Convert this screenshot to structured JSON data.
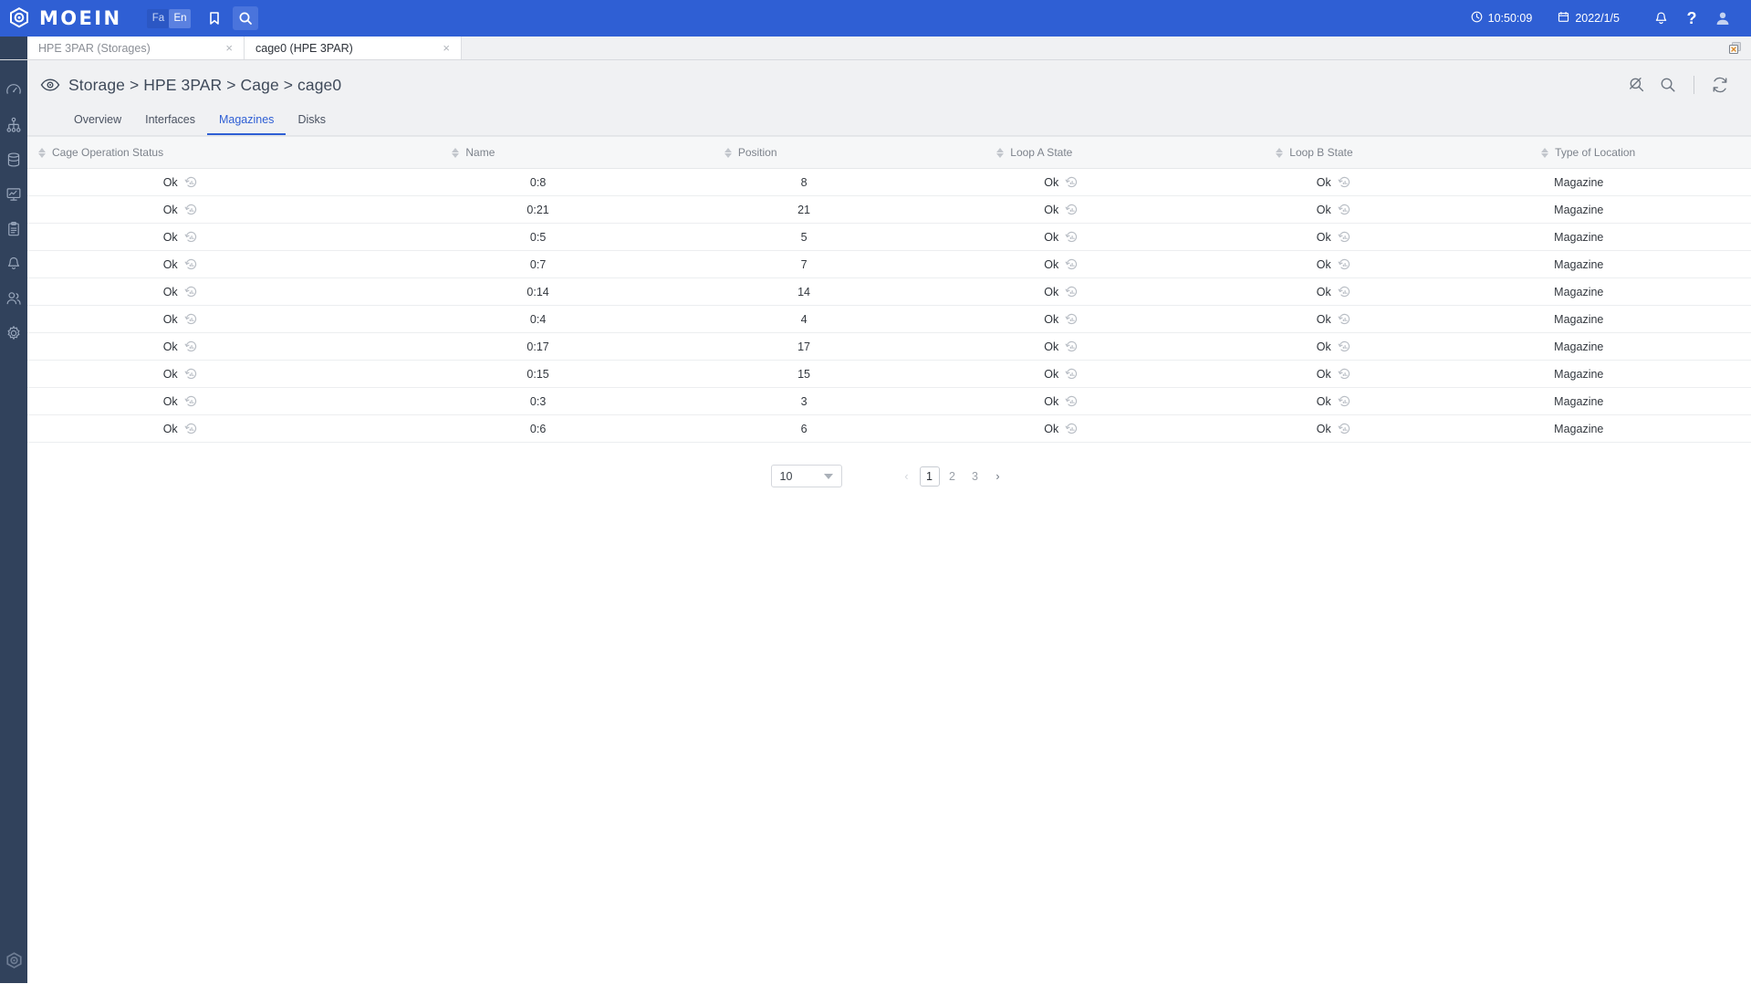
{
  "topbar": {
    "brand": "MOEIN",
    "brand_icon": "moein-logo-icon",
    "languages": [
      {
        "label": "Fa",
        "active": false
      },
      {
        "label": "En",
        "active": true
      }
    ],
    "bookmark_icon": "bookmark-icon",
    "search_icon": "search-icon",
    "time": "10:50:09",
    "time_icon": "clock-icon",
    "date": "2022/1/5",
    "date_icon": "calendar-icon",
    "notification_icon": "bell-icon",
    "help_icon": "question-mark-icon",
    "profile_icon": "user-avatar-icon"
  },
  "tabstrip": {
    "tabs": [
      {
        "label": "HPE 3PAR (Storages)",
        "active": false,
        "close": "×"
      },
      {
        "label": "cage0 (HPE 3PAR)",
        "active": true,
        "close": "×"
      }
    ],
    "close_all_icon": "close-all-tabs-icon"
  },
  "sidebar": {
    "items": [
      {
        "name": "dashboard",
        "icon": "gauge-icon"
      },
      {
        "name": "topology",
        "icon": "hierarchy-icon"
      },
      {
        "name": "storage",
        "icon": "database-icon"
      },
      {
        "name": "monitoring",
        "icon": "monitor-chart-icon"
      },
      {
        "name": "reports",
        "icon": "clipboard-icon"
      },
      {
        "name": "alerts",
        "icon": "bell-icon"
      },
      {
        "name": "users",
        "icon": "users-icon"
      },
      {
        "name": "settings",
        "icon": "gear-icon"
      }
    ],
    "logo_icon": "moein-mark-icon"
  },
  "page": {
    "eye_icon": "eye-icon",
    "breadcrumb": "Storage > HPE 3PAR > Cage > cage0",
    "actions": [
      {
        "name": "clear-search",
        "icon": "search-off-icon"
      },
      {
        "name": "search",
        "icon": "search-icon"
      },
      {
        "name": "refresh",
        "icon": "refresh-icon"
      }
    ],
    "tabs": [
      {
        "label": "Overview",
        "active": false
      },
      {
        "label": "Interfaces",
        "active": false
      },
      {
        "label": "Magazines",
        "active": true
      },
      {
        "label": "Disks",
        "active": false
      }
    ]
  },
  "table": {
    "columns": [
      {
        "label": "Cage Operation Status",
        "sortable": true
      },
      {
        "label": "Name",
        "sortable": true
      },
      {
        "label": "Position",
        "sortable": true
      },
      {
        "label": "Loop A State",
        "sortable": true
      },
      {
        "label": "Loop B State",
        "sortable": true
      },
      {
        "label": "Type of Location",
        "sortable": true
      }
    ],
    "history_icon": "chart-history-icon",
    "rows": [
      {
        "status": "Ok",
        "name": "0:8",
        "position": "8",
        "loop_a": "Ok",
        "loop_b": "Ok",
        "type": "Magazine"
      },
      {
        "status": "Ok",
        "name": "0:21",
        "position": "21",
        "loop_a": "Ok",
        "loop_b": "Ok",
        "type": "Magazine"
      },
      {
        "status": "Ok",
        "name": "0:5",
        "position": "5",
        "loop_a": "Ok",
        "loop_b": "Ok",
        "type": "Magazine"
      },
      {
        "status": "Ok",
        "name": "0:7",
        "position": "7",
        "loop_a": "Ok",
        "loop_b": "Ok",
        "type": "Magazine"
      },
      {
        "status": "Ok",
        "name": "0:14",
        "position": "14",
        "loop_a": "Ok",
        "loop_b": "Ok",
        "type": "Magazine"
      },
      {
        "status": "Ok",
        "name": "0:4",
        "position": "4",
        "loop_a": "Ok",
        "loop_b": "Ok",
        "type": "Magazine"
      },
      {
        "status": "Ok",
        "name": "0:17",
        "position": "17",
        "loop_a": "Ok",
        "loop_b": "Ok",
        "type": "Magazine"
      },
      {
        "status": "Ok",
        "name": "0:15",
        "position": "15",
        "loop_a": "Ok",
        "loop_b": "Ok",
        "type": "Magazine"
      },
      {
        "status": "Ok",
        "name": "0:3",
        "position": "3",
        "loop_a": "Ok",
        "loop_b": "Ok",
        "type": "Magazine"
      },
      {
        "status": "Ok",
        "name": "0:6",
        "position": "6",
        "loop_a": "Ok",
        "loop_b": "Ok",
        "type": "Magazine"
      }
    ]
  },
  "pagination": {
    "page_size": "10",
    "prev_label": "‹",
    "next_label": "›",
    "pages": [
      {
        "label": "1",
        "current": true
      },
      {
        "label": "2",
        "current": false
      },
      {
        "label": "3",
        "current": false
      }
    ]
  },
  "colors": {
    "brand_blue": "#2f5fd4",
    "sidebar_navy": "#31425c",
    "accent": "#2f5fd4",
    "page_bg": "#f0f1f3"
  }
}
